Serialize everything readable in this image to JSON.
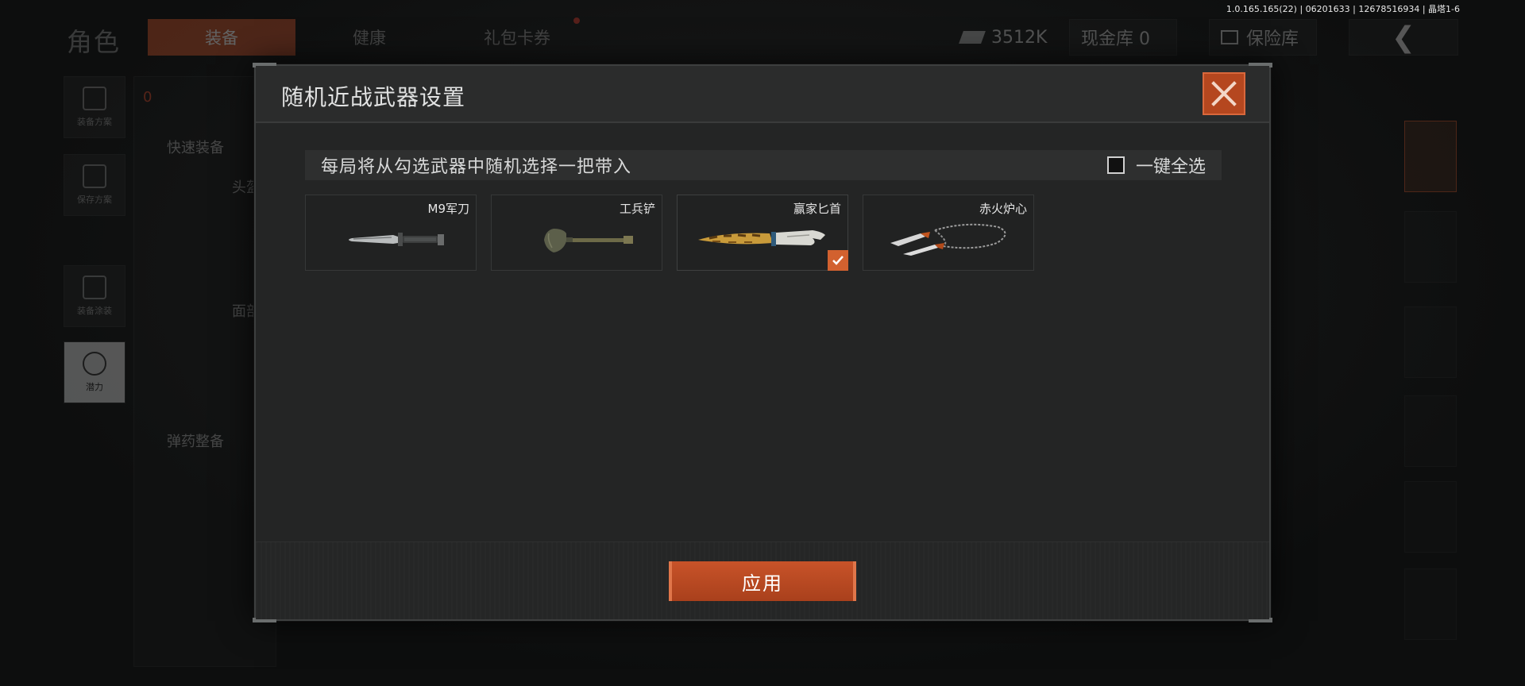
{
  "version_info": "1.0.165.165(22) | 06201633 | 12678516934 | 晶塔1-6",
  "background": {
    "page_title": "角色",
    "tabs": [
      "装备",
      "健康",
      "礼包卡券"
    ],
    "currency_amount": "3512K",
    "cash_storage": "现金库 0",
    "safe_label": "保险库",
    "sidebar": [
      "装备方案",
      "保存方案",
      "装备涂装",
      "潜力"
    ],
    "quick_equip": "快速装备",
    "ammo_equip": "弹药整备",
    "head_label": "头盔",
    "face_label": "面部",
    "counter": "0"
  },
  "modal": {
    "title": "随机近战武器设置",
    "hint": "每局将从勾选武器中随机选择一把带入",
    "select_all_label": "一键全选",
    "apply_label": "应用",
    "weapons": [
      {
        "name": "M9军刀",
        "selected": false,
        "icon": "bayonet-knife-icon"
      },
      {
        "name": "工兵铲",
        "selected": false,
        "icon": "shovel-icon"
      },
      {
        "name": "赢家匕首",
        "selected": true,
        "icon": "golden-dagger-icon"
      },
      {
        "name": "赤火炉心",
        "selected": false,
        "icon": "chain-blades-icon"
      }
    ]
  },
  "colors": {
    "accent": "#c4512a",
    "modal_bg": "#242525"
  }
}
